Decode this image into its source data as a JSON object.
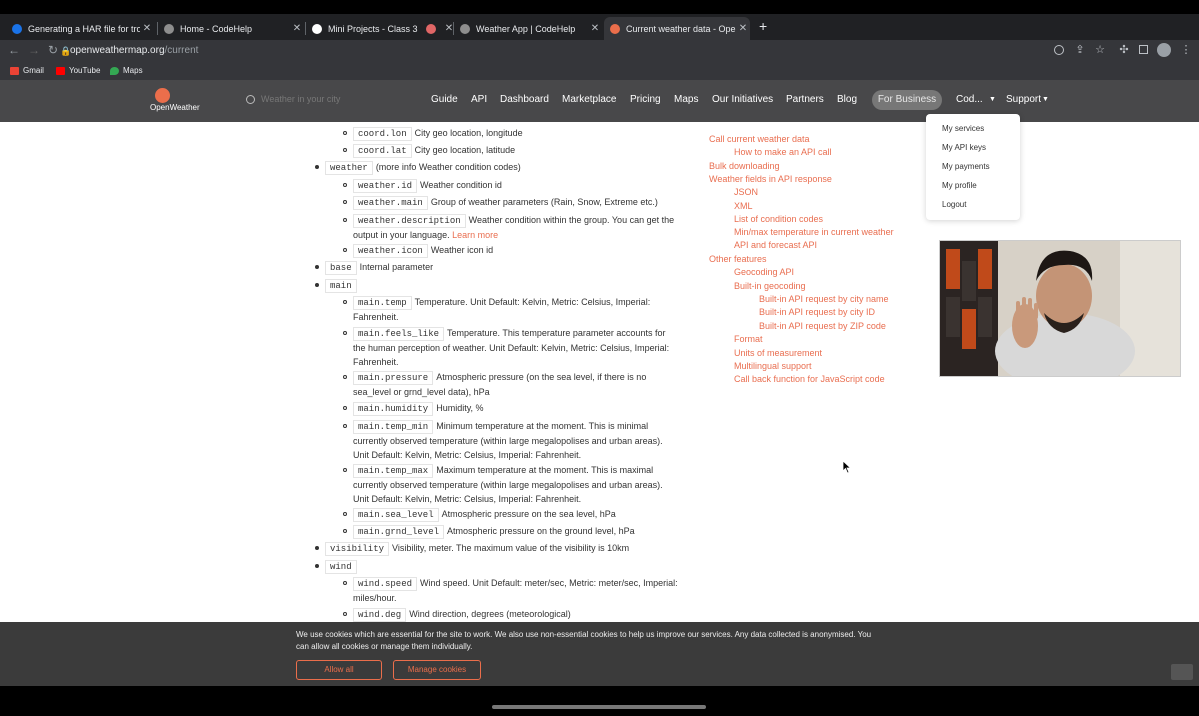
{
  "tabs": [
    {
      "title": "Generating a HAR file for troub",
      "fav": "#1a73e8"
    },
    {
      "title": "Home - CodeHelp",
      "fav": "#8e8e8e"
    },
    {
      "title": "Mini Projects - Class 3",
      "fav": "#ffffff"
    },
    {
      "title": "",
      "fav": "#e06666"
    },
    {
      "title": "Weather App | CodeHelp",
      "fav": "#8e8e8e"
    },
    {
      "title": "Current weather data - OpenW",
      "fav": "#eb6e4b"
    }
  ],
  "url": {
    "host": "openweathermap.org",
    "path": "/current"
  },
  "bookmarks": [
    "Gmail",
    "YouTube",
    "Maps"
  ],
  "site": {
    "logo": "OpenWeather",
    "search_placeholder": "Weather in your city",
    "nav": [
      "Guide",
      "API",
      "Dashboard",
      "Marketplace",
      "Pricing",
      "Maps",
      "Our Initiatives",
      "Partners",
      "Blog"
    ],
    "for_business": "For Business",
    "user": "Cod...",
    "support": "Support"
  },
  "dropdown": [
    "My services",
    "My API keys",
    "My payments",
    "My profile",
    "Logout"
  ],
  "fields": {
    "coord_lon": {
      "k": "coord.lon",
      "t": "City geo location, longitude"
    },
    "coord_lat": {
      "k": "coord.lat",
      "t": "City geo location, latitude"
    },
    "weather": {
      "k": "weather",
      "t": "(more info Weather condition codes)"
    },
    "weather_id": {
      "k": "weather.id",
      "t": "Weather condition id"
    },
    "weather_main": {
      "k": "weather.main",
      "t": "Group of weather parameters (Rain, Snow, Extreme etc.)"
    },
    "weather_description": {
      "k": "weather.description",
      "t": "Weather condition within the group. You can get the output in your language.",
      "link": "Learn more"
    },
    "weather_icon": {
      "k": "weather.icon",
      "t": "Weather icon id"
    },
    "base": {
      "k": "base",
      "t": "Internal parameter"
    },
    "main": {
      "k": "main",
      "t": ""
    },
    "main_temp": {
      "k": "main.temp",
      "t": "Temperature. Unit Default: Kelvin, Metric: Celsius, Imperial: Fahrenheit."
    },
    "main_feels_like": {
      "k": "main.feels_like",
      "t": "Temperature. This temperature parameter accounts for the human perception of weather. Unit Default: Kelvin, Metric: Celsius, Imperial: Fahrenheit."
    },
    "main_pressure": {
      "k": "main.pressure",
      "t": "Atmospheric pressure (on the sea level, if there is no sea_level or grnd_level data), hPa"
    },
    "main_humidity": {
      "k": "main.humidity",
      "t": "Humidity, %"
    },
    "main_temp_min": {
      "k": "main.temp_min",
      "t": "Minimum temperature at the moment. This is minimal currently observed temperature (within large megalopolises and urban areas). Unit Default: Kelvin, Metric: Celsius, Imperial: Fahrenheit."
    },
    "main_temp_max": {
      "k": "main.temp_max",
      "t": "Maximum temperature at the moment. This is maximal currently observed temperature (within large megalopolises and urban areas). Unit Default: Kelvin, Metric: Celsius, Imperial: Fahrenheit."
    },
    "main_sea_level": {
      "k": "main.sea_level",
      "t": "Atmospheric pressure on the sea level, hPa"
    },
    "main_grnd_level": {
      "k": "main.grnd_level",
      "t": "Atmospheric pressure on the ground level, hPa"
    },
    "visibility": {
      "k": "visibility",
      "t": "Visibility, meter. The maximum value of the visibility is 10km"
    },
    "wind": {
      "k": "wind",
      "t": ""
    },
    "wind_speed": {
      "k": "wind.speed",
      "t": "Wind speed. Unit Default: meter/sec, Metric: meter/sec, Imperial: miles/hour."
    },
    "wind_deg": {
      "k": "wind.deg",
      "t": "Wind direction, degrees (meteorological)"
    }
  },
  "toc": [
    "Call current weather data",
    "How to make an API call",
    "Bulk downloading",
    "Weather fields in API response",
    "JSON",
    "XML",
    "List of condition codes",
    "Min/max temperature in current weather API and forecast API",
    "Other features",
    "Geocoding API",
    "Built-in geocoding",
    "Built-in API request by city name",
    "Built-in API request by city ID",
    "Built-in API request by ZIP code",
    "Format",
    "Units of measurement",
    "Multilingual support",
    "Call back function for JavaScript code"
  ],
  "cookie": {
    "message": "We use cookies which are essential for the site to work. We also use non-essential cookies to help us improve our services. Any data collected is anonymised. You can allow all cookies or manage them individually.",
    "allow": "Allow all",
    "manage": "Manage cookies"
  }
}
